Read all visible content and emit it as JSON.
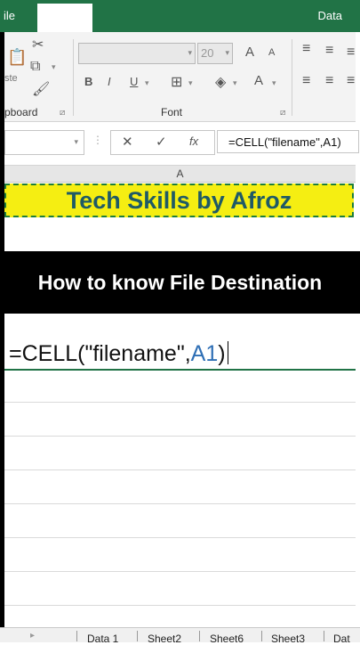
{
  "ribbon": {
    "tab_file": "ile",
    "tab_data": "Data",
    "clipboard_partial": "ste",
    "group_clipboard": "pboard",
    "group_font": "Font",
    "font_size": "20",
    "bold": "B",
    "italic": "I",
    "underline": "U",
    "font_color": "A",
    "grow_font": "A",
    "shrink_font": "A"
  },
  "formula_bar": {
    "cancel": "✕",
    "enter": "✓",
    "fx": "fx",
    "formula": "=CELL(\"filename\",A1)"
  },
  "grid": {
    "column_a": "A",
    "banner_text": "Tech Skills by Afroz",
    "caption": "How to know File Destination",
    "edit_prefix": "=CELL(\"filename\",",
    "edit_ref": "A1",
    "edit_suffix": ")"
  },
  "sheets": [
    "Data 1",
    "Sheet2",
    "Sheet6",
    "Sheet3",
    "Dat"
  ],
  "colors": {
    "excel_green": "#217346",
    "banner_fill": "#f5ee12",
    "banner_text": "#1f5a66",
    "cell_ref_blue": "#2f6fb5"
  }
}
